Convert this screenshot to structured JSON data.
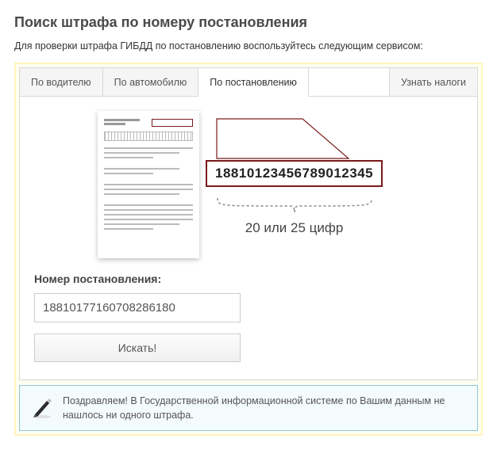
{
  "title": "Поиск штрафа по номеру постановления",
  "subtitle": "Для проверки штрафа ГИБДД по постановлению воспользуйтесь следующим сервисом:",
  "tabs": {
    "driver": "По водителю",
    "car": "По автомобилю",
    "resolution": "По постановлению",
    "taxes": "Узнать налоги"
  },
  "illustration": {
    "example_number": "18810123456789012345",
    "digits_hint": "20 или 25 цифр"
  },
  "form": {
    "label": "Номер постановления:",
    "value": "18810177160708286180",
    "placeholder": "",
    "submit": "Искать!"
  },
  "result": {
    "message": "Поздравляем! В Государственной информационной системе по Вашим данным не нашлось ни одного штрафа."
  }
}
